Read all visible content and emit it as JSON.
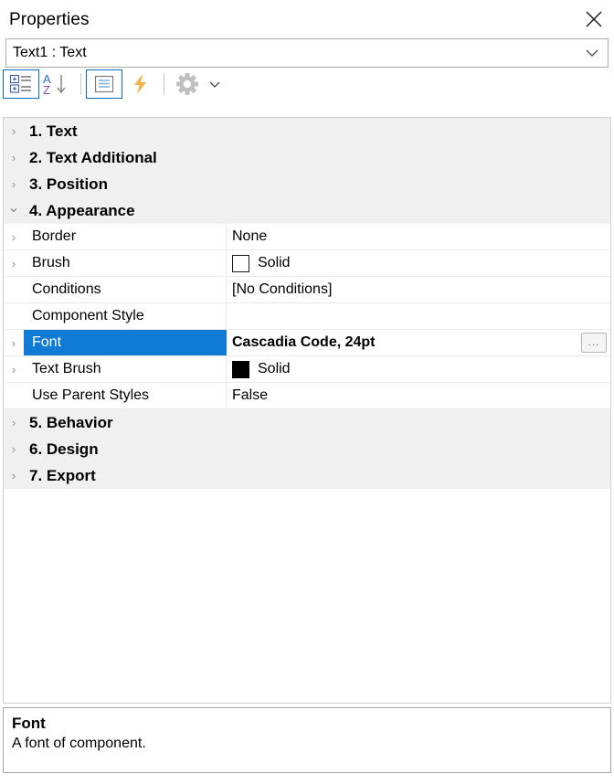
{
  "window": {
    "title": "Properties",
    "close_icon": "close-icon"
  },
  "selector": {
    "value": "Text1 : Text",
    "dropdown_icon": "chevron-down-icon"
  },
  "toolbar": {
    "buttons": [
      {
        "name": "categorized-view",
        "icon": "categorized-list-icon",
        "toggled": true
      },
      {
        "name": "alphabetical-sort",
        "icon": "sort-az-icon",
        "toggled": false
      },
      {
        "name": "property-pages",
        "icon": "property-pages-icon",
        "toggled": true
      },
      {
        "name": "events",
        "icon": "lightning-bolt-icon",
        "toggled": false
      },
      {
        "name": "settings",
        "icon": "gear-icon",
        "toggled": false
      },
      {
        "name": "settings-dropdown",
        "icon": "chevron-down-icon",
        "toggled": false
      }
    ]
  },
  "grid": {
    "rows": [
      {
        "kind": "category",
        "label": "1. Text",
        "expanded": false
      },
      {
        "kind": "category",
        "label": "2. Text  Additional",
        "expanded": false
      },
      {
        "kind": "category",
        "label": "3. Position",
        "expanded": false
      },
      {
        "kind": "category",
        "label": "4. Appearance",
        "expanded": true
      },
      {
        "kind": "property",
        "name": "Border",
        "value": "None",
        "expandable": true,
        "selected": false,
        "swatch": null,
        "ellipsis": false
      },
      {
        "kind": "property",
        "name": "Brush",
        "value": "Solid",
        "expandable": true,
        "selected": false,
        "swatch": "#ffffff",
        "swatch_outlined": true,
        "ellipsis": false
      },
      {
        "kind": "property",
        "name": "Conditions",
        "value": "[No Conditions]",
        "expandable": false,
        "selected": false,
        "swatch": null,
        "ellipsis": false
      },
      {
        "kind": "property",
        "name": "Component Style",
        "value": "",
        "expandable": false,
        "selected": false,
        "swatch": null,
        "ellipsis": false
      },
      {
        "kind": "property",
        "name": "Font",
        "value": "Cascadia Code, 24pt",
        "expandable": true,
        "selected": true,
        "swatch": null,
        "ellipsis": true,
        "ellipsis_label": "..."
      },
      {
        "kind": "property",
        "name": "Text Brush",
        "value": "Solid",
        "expandable": true,
        "selected": false,
        "swatch": "#000000",
        "swatch_outlined": false,
        "ellipsis": false
      },
      {
        "kind": "property",
        "name": "Use Parent Styles",
        "value": "False",
        "expandable": false,
        "selected": false,
        "swatch": null,
        "ellipsis": false
      },
      {
        "kind": "category",
        "label": "5. Behavior",
        "expanded": false
      },
      {
        "kind": "category",
        "label": "6. Design",
        "expanded": false
      },
      {
        "kind": "category",
        "label": "7. Export",
        "expanded": false
      }
    ]
  },
  "description": {
    "title": "Font",
    "text": "A font of component."
  },
  "colors": {
    "selection": "#0f7bd4",
    "category_background": "#f0f0f0",
    "accent_blue": "#0a6cbc",
    "bolt_orange": "#f0b44b"
  }
}
